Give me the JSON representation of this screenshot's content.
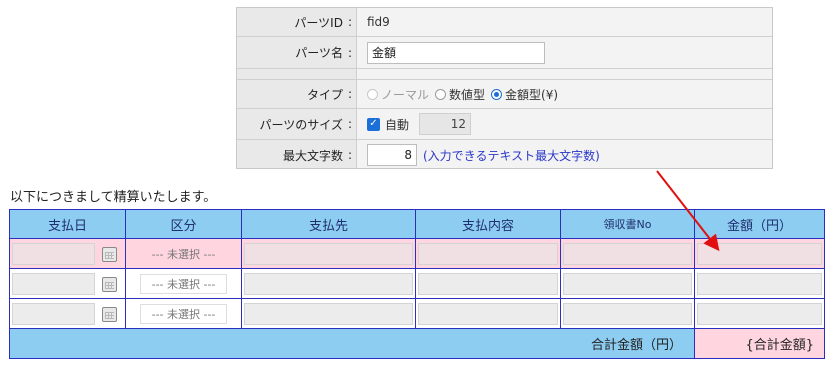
{
  "panel": {
    "rows": [
      {
        "label": "パーツID",
        "colon": ":",
        "value": "fid9"
      },
      {
        "label": "パーツ名",
        "colon": ":",
        "input": "金額"
      },
      {
        "label": "タイプ",
        "colon": ":",
        "radios": [
          {
            "label": "ノーマル",
            "state": "disabled"
          },
          {
            "label": "数値型",
            "state": "off"
          },
          {
            "label": "金額型(¥)",
            "state": "on"
          }
        ]
      },
      {
        "label": "パーツのサイズ",
        "colon": ":",
        "check_label": "自動",
        "size_value": "12"
      },
      {
        "label": "最大文字数",
        "colon": ":",
        "number": "8",
        "hint": "(入力できるテキスト最大文字数)"
      }
    ]
  },
  "intro": "以下につきまして精算いたします。",
  "table": {
    "headers": [
      "支払日",
      "区分",
      "支払先",
      "支払内容",
      "領収書No",
      "金額（円）"
    ],
    "select_placeholder": "--- 未選択 ---",
    "total_label": "合計金額（円）",
    "total_value": "{合計金額}"
  },
  "colors": {
    "header_bg": "#8ecdf2",
    "border": "#2a2fbf",
    "highlight": "#ffd6df",
    "arrow": "#e01010"
  }
}
